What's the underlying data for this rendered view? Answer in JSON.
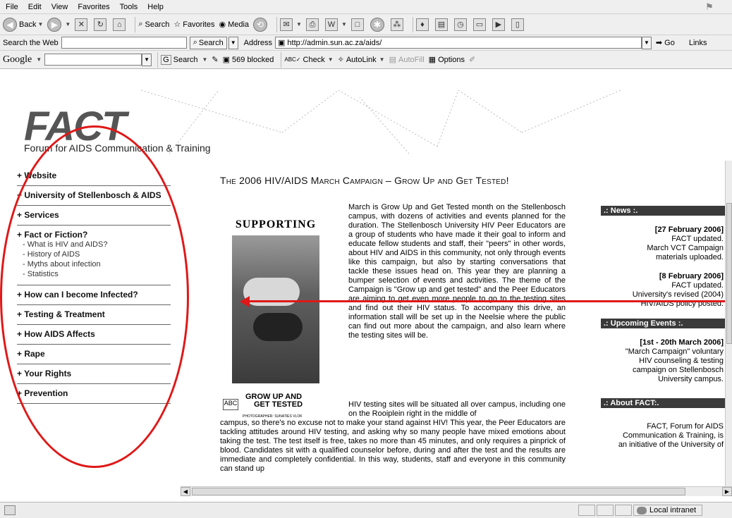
{
  "browser": {
    "menu": [
      "File",
      "Edit",
      "View",
      "Favorites",
      "Tools",
      "Help"
    ],
    "toolbar": {
      "back": "Back",
      "search": "Search",
      "favorites": "Favorites",
      "media": "Media"
    },
    "search_web_label": "Search the Web",
    "search_button": "Search",
    "address_label": "Address",
    "address_value": "http://admin.sun.ac.za/aids/",
    "go_button": "Go",
    "links_label": "Links",
    "google": {
      "logo": "Google",
      "search_button": "Search",
      "blocked": "569 blocked",
      "check": "Check",
      "autolink": "AutoLink",
      "autofill": "AutoFill",
      "options": "Options"
    },
    "status_zone": "Local intranet"
  },
  "site": {
    "logo": "FACT",
    "tagline": "Forum for AIDS Communication & Training"
  },
  "nav": {
    "items": [
      {
        "label": "+ Website"
      },
      {
        "label": "+ University of Stellenbosch & AIDS"
      },
      {
        "label": "+ Services"
      },
      {
        "label": "+ Fact or Fiction?",
        "subs": [
          "- What is HIV and AIDS?",
          "- History of AIDS",
          "- Myths about infection",
          "- Statistics"
        ]
      },
      {
        "label": "+ How can I become Infected?"
      },
      {
        "label": "+ Testing & Treatment"
      },
      {
        "label": "+ How AIDS Affects"
      },
      {
        "label": "+ Rape"
      },
      {
        "label": "+ Your Rights"
      },
      {
        "label": "+ Prevention"
      }
    ]
  },
  "main": {
    "headline": "The 2006 HIV/AIDS March Campaign – Grow Up and Get Tested!",
    "poster_top": "SUPPORTING",
    "poster_grow": "GROW UP AND",
    "poster_tested": "GET TESTED",
    "poster_credit": "PHOTOGRAPHER: SUNATIES VLOK",
    "paragraph1": "March is Grow Up and Get Tested month on the Stellenbosch campus, with dozens of activities and events planned for the duration. The Stellenbosch University HIV Peer Educators are a group of students who have made it their goal to inform and educate fellow students and staff, their \"peers\" in other words, about HIV and AIDS in this community, not only through events like this campaign, but also by starting conversations that tackle these issues head on. This year they are planning a bumper selection of events and activities. The theme of the Campaign is \"Grow up and get tested\" and the Peer Educators are aiming to get even more people to go to the testing sites and find out their HIV status. To accompany this drive, an information stall will be set up in the Neelsie where the public can find out more about the campaign, and also learn where the testing sites will be.",
    "paragraph2a": "HIV testing sites will be situated all over campus, including one on the Rooiplein right in the middle of",
    "paragraph2b": "campus, so there's no excuse not to make your stand against HIV! This year, the Peer Educators are tackling attitudes around HIV testing, and asking why so many people have mixed emotions about taking the test. The test itself is free, takes no more than 45 minutes, and only requires a pinprick of blood. Candidates sit with a qualified counselor before, during and after the test and the results are immediate and completely confidential. In this way, students, staff and everyone in this community can stand up"
  },
  "sidebar": {
    "news_title": ".: News :.",
    "news": [
      {
        "date": "[27 February 2006]",
        "lines": [
          "FACT updated.",
          "March VCT Campaign",
          "materials uploaded."
        ]
      },
      {
        "date": "[8 February 2006]",
        "lines": [
          "FACT updated.",
          "University's revised (2004)",
          "HIV/AIDS policy posted."
        ]
      }
    ],
    "events_title": ".: Upcoming Events :.",
    "events": [
      {
        "date": "[1st - 20th March 2006]",
        "lines": [
          "\"March Campaign\" voluntary",
          "HIV counseling & testing",
          "campaign on Stellenbosch",
          "University campus."
        ]
      }
    ],
    "about_title": ".: About FACT:.",
    "about_lines": [
      "FACT, Forum for AIDS",
      "Communication & Training, is",
      "an initiative of the University of"
    ]
  },
  "colors": {
    "annotation_red": "#e01818",
    "sidebar_header": "#3a3a3a"
  }
}
